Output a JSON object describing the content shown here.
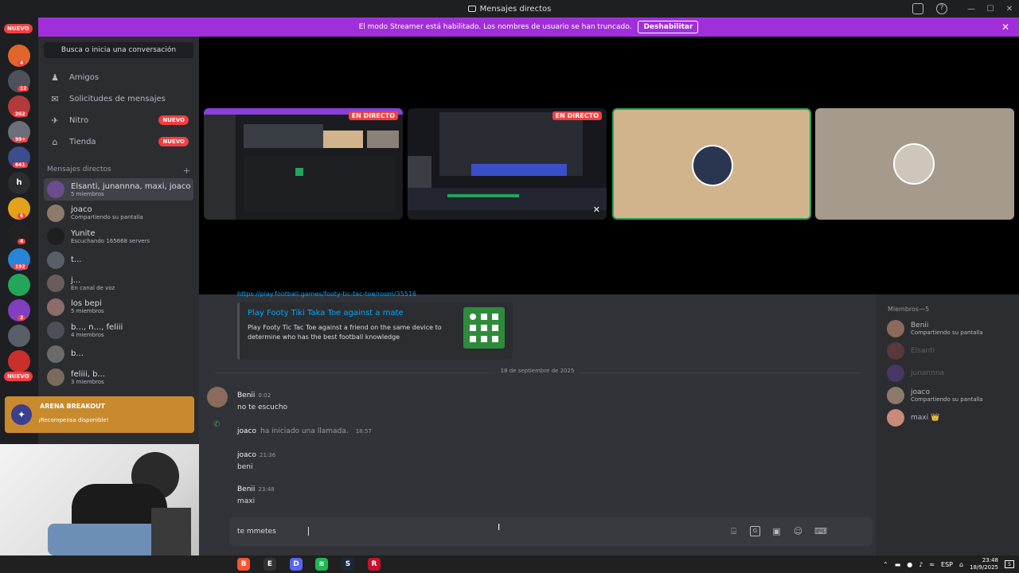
{
  "window": {
    "title": "Mensajes directos",
    "controls": [
      "—",
      "☐",
      "✕"
    ]
  },
  "banner": {
    "text": "El modo Streamer está habilitado. Los nombres de usuario se han truncado.",
    "button": "Deshabilitar"
  },
  "guilds": {
    "top_badge": "NUEVO",
    "bottom_badge": "NUEVO",
    "letter_server": "h",
    "items": [
      {
        "color": "#e0662b",
        "badge": "4"
      },
      {
        "color": "#4d5159",
        "badge": "12"
      },
      {
        "color": "#b33a3a",
        "badge": "262"
      },
      {
        "color": "#6a6f7a",
        "badge": "99+"
      },
      {
        "color": "#3c4c8c",
        "badge": "641"
      },
      {
        "color": "#2b2d31",
        "badge": ""
      },
      {
        "color": "#e3a21a",
        "badge": "6"
      },
      {
        "color": "#222222",
        "badge": "4"
      },
      {
        "color": "#2a84d6",
        "badge": "192"
      },
      {
        "color": "#23a55a",
        "badge": ""
      },
      {
        "color": "#7f3fbf",
        "badge": "2"
      },
      {
        "color": "#5a5e66",
        "badge": ""
      },
      {
        "color": "#c9302c",
        "badge": ""
      }
    ]
  },
  "dm_sidebar": {
    "search": "Busca o inicia una conversación",
    "nav": [
      {
        "label": "Amigos",
        "icon": "friends-icon",
        "glyph": "♟",
        "badge": ""
      },
      {
        "label": "Solicitudes de mensajes",
        "icon": "envelope-icon",
        "glyph": "✉",
        "badge": ""
      },
      {
        "label": "Nitro",
        "icon": "nitro-icon",
        "glyph": "✈",
        "badge": "NUEVO"
      },
      {
        "label": "Tienda",
        "icon": "shop-icon",
        "glyph": "⌂",
        "badge": "NUEVO"
      }
    ],
    "section": "Mensajes directos",
    "add": "+",
    "dms": [
      {
        "name": "Elsanti, junannna, maxi, joaco",
        "sub": "5 miembros",
        "color": "#6b4c8c"
      },
      {
        "name": "joaco",
        "sub": "Compartiendo su pantalla",
        "color": "#8c7a6b"
      },
      {
        "name": "Yunite",
        "sub": "Escuchando 165668 servers",
        "color": "#1f1f1f"
      },
      {
        "name": "t...",
        "sub": "",
        "color": "#5a5e66"
      },
      {
        "name": "j...",
        "sub": "En canal de voz",
        "color": "#6b5c5c"
      },
      {
        "name": "los bepi",
        "sub": "5 miembros",
        "color": "#8c6b6b"
      },
      {
        "name": "b..., n..., feliii",
        "sub": "4 miembros",
        "color": "#4e5058"
      },
      {
        "name": "b...",
        "sub": "",
        "color": "#6b6b6b"
      },
      {
        "name": "feliii, b...",
        "sub": "3 miembros",
        "color": "#7a6b5c"
      }
    ]
  },
  "promo": {
    "title": "ARENA BREAKOUT",
    "subtitle": "¡Recompensa disponible!"
  },
  "stage": {
    "tiles": [
      {
        "type": "stream",
        "live": "EN DIRECTO",
        "bg": "#1b1c20"
      },
      {
        "type": "stream",
        "live": "EN DIRECTO",
        "bg": "#16181d"
      },
      {
        "type": "avatar",
        "bg": "#d2b48c",
        "speaking": true
      },
      {
        "type": "avatar",
        "bg": "#a59a8b",
        "speaking": false
      }
    ]
  },
  "chat": {
    "link_text": "https://play.football.games/footy-tic-tac-toe/room/35516",
    "embed": {
      "title": "Play Footy Tiki Taka Toe against a mate",
      "desc": "Play Footy Tic Tac Toe against a friend on the same device to determine who has the best football knowledge"
    },
    "date_divider": "18 de septiembre de 2025",
    "messages": [
      {
        "author": "Benii",
        "time": "0:02",
        "text": "no te escucho"
      },
      {
        "author": "joaco",
        "time": "21:36",
        "text": "beni"
      },
      {
        "author": "Benii",
        "time": "23:48",
        "text": "maxi"
      }
    ],
    "call": {
      "author": "joaco",
      "text": "ha iniciado una llamada.",
      "time": "18:57"
    },
    "input_value": "te mmetes"
  },
  "members": {
    "header": "Miembros—5",
    "list": [
      {
        "name": "Benii",
        "sub": "Compartiendo su pantalla",
        "online": true,
        "color": "#8c6b5c"
      },
      {
        "name": "Elsanti",
        "sub": "",
        "online": false,
        "color": "#b05050"
      },
      {
        "name": "junannna",
        "sub": "",
        "online": false,
        "color": "#7a4fbf"
      },
      {
        "name": "joaco",
        "sub": "Compartiendo su pantalla",
        "online": true,
        "color": "#8c7a6b"
      },
      {
        "name": "maxi 👑",
        "sub": "",
        "online": true,
        "color": "#c98a7a"
      }
    ]
  },
  "taskbar": {
    "apps": [
      {
        "color": "#fb542b",
        "glyph": "B"
      },
      {
        "color": "#333333",
        "glyph": "E"
      },
      {
        "color": "#5865f2",
        "glyph": "D"
      },
      {
        "color": "#1db954",
        "glyph": "≋"
      },
      {
        "color": "#1b2838",
        "glyph": "S"
      },
      {
        "color": "#c8102e",
        "glyph": "R"
      }
    ],
    "lang": "ESP",
    "time": "23:48",
    "date": "18/9/2025",
    "notif": "5"
  }
}
